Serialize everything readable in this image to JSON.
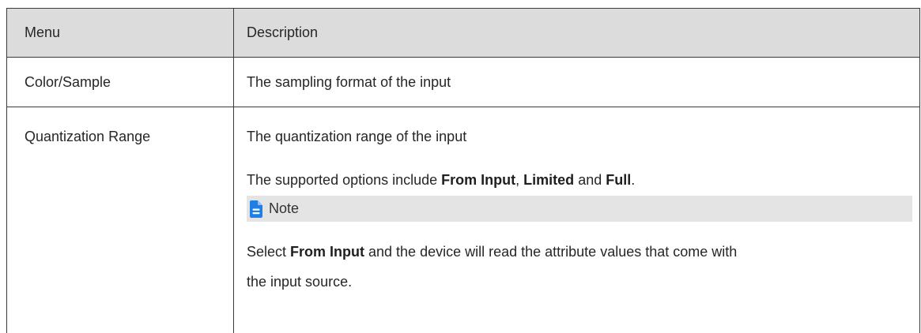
{
  "table": {
    "headers": {
      "menu": "Menu",
      "description": "Description"
    },
    "rows": [
      {
        "menu": "Color/Sample",
        "description": "The sampling format of the input"
      },
      {
        "menu": "Quantization Range",
        "description": "The quantization range of the input",
        "options": {
          "prefix": "The supported options include ",
          "option1": "From Input",
          "sep1": ", ",
          "option2": "Limited",
          "sep2": " and ",
          "option3": "Full",
          "suffix": "."
        },
        "note": {
          "icon": "note-document-icon",
          "label": "Note",
          "prefix": "Select ",
          "bold": "From Input",
          "line1_rest": " and the device will read the attribute values that come with",
          "line2": "the input source."
        }
      }
    ]
  },
  "colors": {
    "header_background": "#dcdcdc",
    "note_background": "#e4e4e4",
    "note_icon": "#1e7fe6",
    "border": "#3a3a3a"
  }
}
